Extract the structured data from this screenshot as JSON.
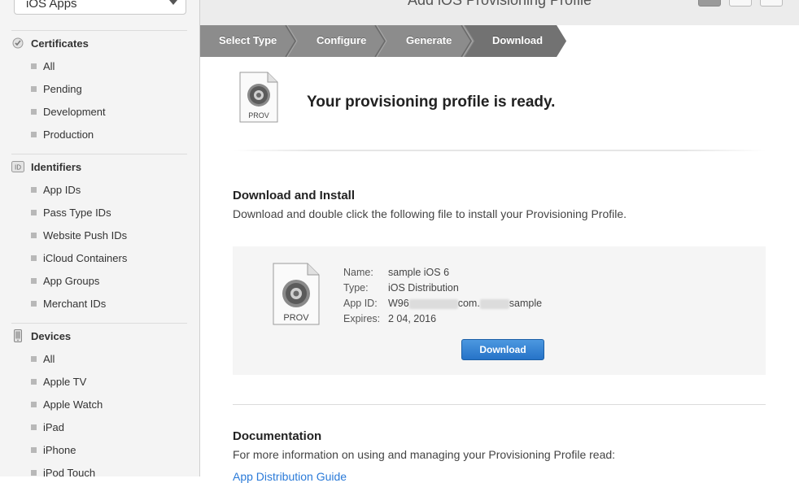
{
  "sidebar": {
    "platform_select": "iOS Apps",
    "sections": [
      {
        "title": "Certificates",
        "icon": "certificate-icon",
        "items": [
          "All",
          "Pending",
          "Development",
          "Production"
        ]
      },
      {
        "title": "Identifiers",
        "icon": "id-badge-icon",
        "icon_text": "ID",
        "items": [
          "App IDs",
          "Pass Type IDs",
          "Website Push IDs",
          "iCloud Containers",
          "App Groups",
          "Merchant IDs"
        ]
      },
      {
        "title": "Devices",
        "icon": "device-icon",
        "items": [
          "All",
          "Apple TV",
          "Apple Watch",
          "iPad",
          "iPhone",
          "iPod Touch"
        ]
      }
    ]
  },
  "header": {
    "title": "Add iOS Provisioning Profile"
  },
  "steps": [
    "Select Type",
    "Configure",
    "Generate",
    "Download"
  ],
  "hero": {
    "icon_label": "PROV",
    "title": "Your provisioning profile is ready."
  },
  "download_install": {
    "heading": "Download and Install",
    "description": "Download and double click the following file to install your Provisioning Profile."
  },
  "profile": {
    "icon_label": "PROV",
    "name_label": "Name:",
    "name_value": "sample iOS 6",
    "type_label": "Type:",
    "type_value": "iOS Distribution",
    "appid_label": "App ID:",
    "appid_prefix": "W96",
    "appid_middle": "com.",
    "appid_suffix": "sample",
    "expires_label": "Expires:",
    "expires_value": "2 04, 2016"
  },
  "download_button": "Download",
  "documentation": {
    "heading": "Documentation",
    "description": "For more information on using and managing your Provisioning Profile read:",
    "link": "App Distribution Guide"
  },
  "colors": {
    "accent": "#2673c8",
    "step_bar": "#8a8a8a",
    "step_active": "#6f6f6f",
    "link": "#2a7ad8"
  }
}
